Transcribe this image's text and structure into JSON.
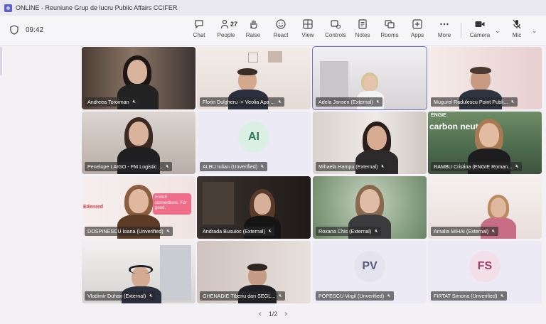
{
  "window": {
    "title": "ONLINE - Reuniune Grup de lucru Public Affairs CCIFER"
  },
  "meeting": {
    "timer": "09:42"
  },
  "toolbar": {
    "people_count": "27",
    "buttons": [
      {
        "label": "Chat",
        "icon": "chat-icon"
      },
      {
        "label": "People",
        "icon": "people-icon"
      },
      {
        "label": "Raise",
        "icon": "raise-hand-icon"
      },
      {
        "label": "React",
        "icon": "react-icon"
      },
      {
        "label": "View",
        "icon": "view-icon"
      },
      {
        "label": "Controls",
        "icon": "controls-icon"
      },
      {
        "label": "Notes",
        "icon": "notes-icon"
      },
      {
        "label": "Rooms",
        "icon": "rooms-icon"
      },
      {
        "label": "Apps",
        "icon": "apps-icon"
      },
      {
        "label": "More",
        "icon": "more-icon"
      },
      {
        "label": "Camera",
        "icon": "camera-icon"
      },
      {
        "label": "Mic",
        "icon": "mic-off-icon"
      }
    ]
  },
  "participants": [
    {
      "name": "Andreea Toroiman"
    },
    {
      "name": "Florin Dulgheru -> Veolia Apa ..."
    },
    {
      "name": "Adela Jansen (External)"
    },
    {
      "name": "Mugurel Radulescu Point Publi..."
    },
    {
      "name": "Penelope LAIGO - FM Logistic ..."
    },
    {
      "name": "ALBU Iulian (Unverified)",
      "initials": "AI"
    },
    {
      "name": "Mihaela Hampu (External)"
    },
    {
      "name": "RAMBU Cristina (ENGIE Roman..."
    },
    {
      "name": "DOSPINESCU Ioana (Unverified)"
    },
    {
      "name": "Andrada Busuioc (External)"
    },
    {
      "name": "Roxana Chis (External)"
    },
    {
      "name": "Amalia MIHAI (External)"
    },
    {
      "name": "Vladimir Duhan (External)"
    },
    {
      "name": "GHENADIE Tiberiu dan SEGL..."
    },
    {
      "name": "POPESCU Virgil (Unverified)",
      "initials": "PV"
    },
    {
      "name": "FIRTAT Simona (Unverified)",
      "initials": "FS"
    }
  ],
  "overlays": {
    "banner_text": "carbon neut",
    "logo_text": "ENGIE",
    "sign_text": "Enrich connections. For good.",
    "brand_text": "Edenred"
  },
  "pager": {
    "label": "1/2"
  },
  "colors": {
    "accent": "#5b5fc7",
    "ai_avatar": "#2e7d5b",
    "pv_avatar": "#5a5a7a",
    "fs_avatar": "#a03c6c"
  }
}
